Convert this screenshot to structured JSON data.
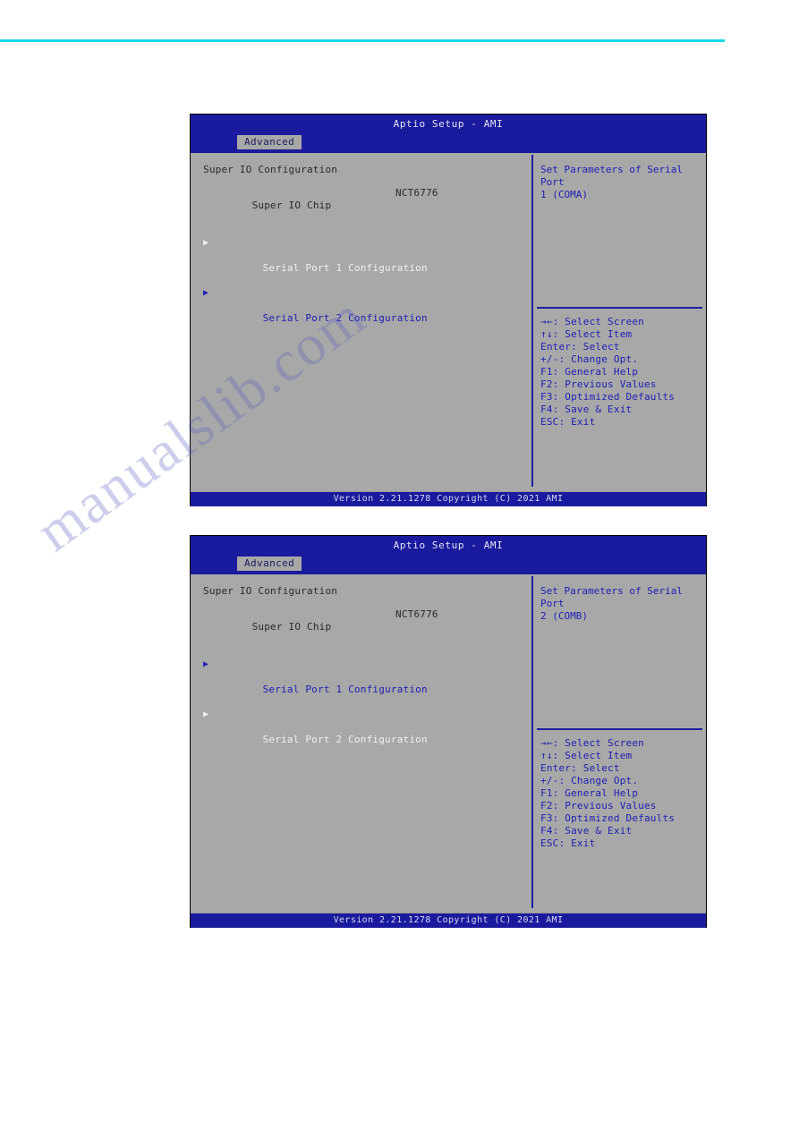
{
  "page": {
    "rule_color": "#19D7E8",
    "watermark": "manualslib.com"
  },
  "screens": [
    {
      "title": "Aptio Setup - AMI",
      "tab": "Advanced",
      "section_heading": "Super IO Configuration",
      "chip": {
        "label": "Super IO Chip",
        "value": "NCT6776"
      },
      "menu": [
        {
          "arrow": "▶",
          "label": "Serial Port 1 Configuration",
          "state": "selected"
        },
        {
          "arrow": "▶",
          "label": "Serial Port 2 Configuration",
          "state": "normal"
        }
      ],
      "help": {
        "description_line1": "Set Parameters of Serial Port",
        "description_line2": "1 (COMA)",
        "keys": [
          "→←: Select Screen",
          "↑↓: Select Item",
          "Enter: Select",
          "+/-: Change Opt.",
          "F1: General Help",
          "F2: Previous Values",
          "F3: Optimized Defaults",
          "F4: Save & Exit",
          "ESC: Exit"
        ]
      },
      "footer": "Version 2.21.1278 Copyright (C) 2021 AMI"
    },
    {
      "title": "Aptio Setup - AMI",
      "tab": "Advanced",
      "section_heading": "Super IO Configuration",
      "chip": {
        "label": "Super IO Chip",
        "value": "NCT6776"
      },
      "menu": [
        {
          "arrow": "▶",
          "label": "Serial Port 1 Configuration",
          "state": "normal"
        },
        {
          "arrow": "▶",
          "label": "Serial Port 2 Configuration",
          "state": "selected"
        }
      ],
      "help": {
        "description_line1": "Set Parameters of Serial Port",
        "description_line2": "2 (COMB)",
        "keys": [
          "→←: Select Screen",
          "↑↓: Select Item",
          "Enter: Select",
          "+/-: Change Opt.",
          "F1: General Help",
          "F2: Previous Values",
          "F3: Optimized Defaults",
          "F4: Save & Exit",
          "ESC: Exit"
        ]
      },
      "footer": "Version 2.21.1278 Copyright (C) 2021 AMI"
    }
  ]
}
